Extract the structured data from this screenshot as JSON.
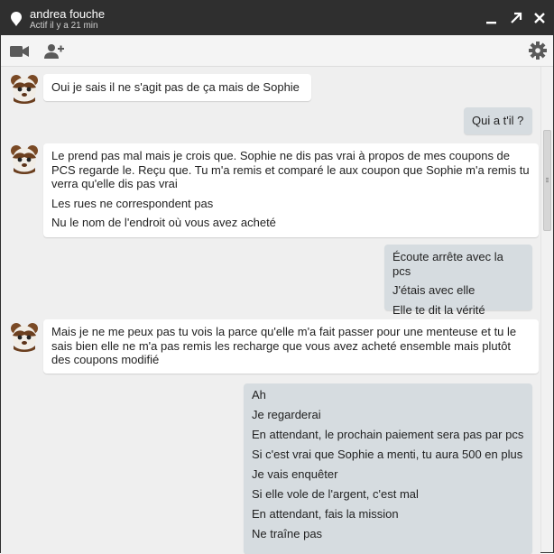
{
  "contact": {
    "name": "andrea fouche",
    "status": "Actif il y a 21 min"
  },
  "window_controls": [
    "minimize-icon",
    "popout-icon",
    "close-icon"
  ],
  "toolbar": {
    "icons": [
      "video-call-icon",
      "add-person-icon",
      "settings-gear-icon"
    ]
  },
  "messages": [
    {
      "from": "contact",
      "lines": [
        "Oui je sais il ne s'agit pas de ça mais de Sophie"
      ]
    },
    {
      "from": "me",
      "lines": [
        "Qui a t'il ?"
      ]
    },
    {
      "from": "contact",
      "lines": [
        "Le prend pas mal mais je crois que. Sophie ne dis pas vrai à propos de mes coupons de PCS regarde le. Reçu que. Tu m'a remis et comparé le aux coupon que Sophie m'a remis tu verra qu'elle dis pas vrai",
        "Les rues ne correspondent pas",
        "Nu le nom de l'endroit où vous avez acheté"
      ]
    },
    {
      "from": "me",
      "lines": [
        "Écoute arrête avec la pcs",
        "J'étais avec elle",
        "Elle te dit la vérité"
      ]
    },
    {
      "from": "contact",
      "lines": [
        "Mais je ne me peux pas tu vois la parce qu'elle m'a fait passer pour une menteuse et tu le sais bien elle ne m'a pas remis les recharge que vous avez acheté ensemble mais plutôt des coupons modifié"
      ]
    },
    {
      "from": "me",
      "lines": [
        "Ah",
        "Je regarderai",
        "En attendant, le prochain paiement sera pas par pcs",
        "Si c'est vrai que Sophie a menti, tu aura 500 en plus",
        "Je vais enquêter",
        "Si elle vole de l'argent, c'est mal",
        "En attendant, fais la mission",
        "Ne traîne pas"
      ]
    }
  ],
  "colors": {
    "titlebar": "#2f2f2f",
    "incoming_bubble": "#ffffff",
    "outgoing_bubble": "#d6dce0",
    "chat_background": "#efefef"
  }
}
